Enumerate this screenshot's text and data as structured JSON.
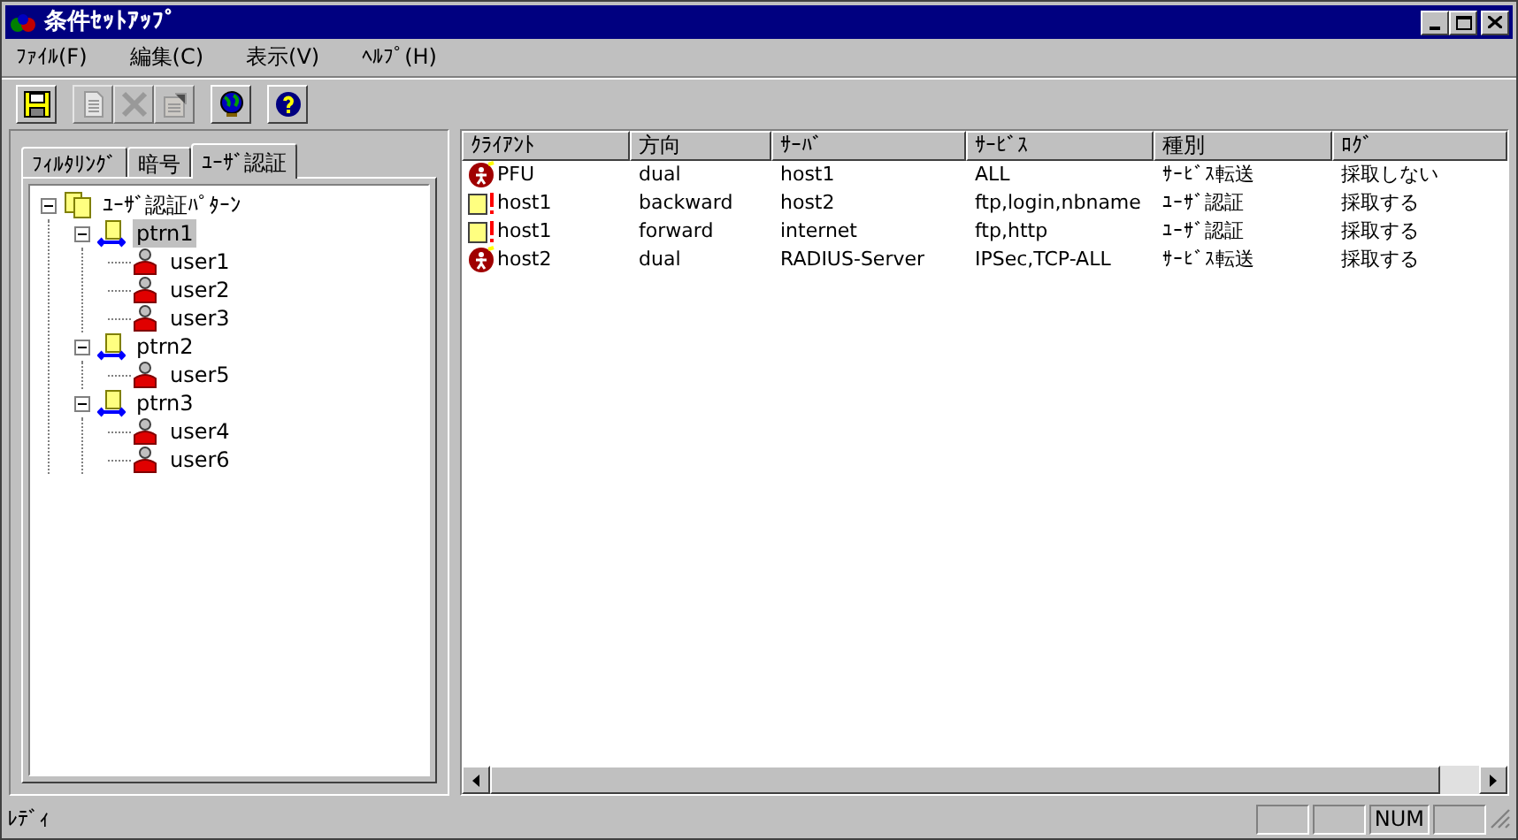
{
  "window": {
    "title": "条件ｾｯﾄｱｯﾌﾟ"
  },
  "menu": [
    "ﾌｧｲﾙ(F)",
    "編集(C)",
    "表示(V)",
    "ﾍﾙﾌﾟ(H)"
  ],
  "toolbar": [
    {
      "kind": "save",
      "disabled": false
    },
    {
      "kind": "new",
      "disabled": true
    },
    {
      "kind": "delete",
      "disabled": true
    },
    {
      "kind": "properties",
      "disabled": true
    },
    {
      "kind": "globe",
      "disabled": false
    },
    {
      "kind": "help",
      "disabled": false
    }
  ],
  "tabs": [
    {
      "label": "ﾌｨﾙﾀﾘﾝｸﾞ",
      "selected": false
    },
    {
      "label": "暗号",
      "selected": false
    },
    {
      "label": "ﾕｰｻﾞ認証",
      "selected": true
    }
  ],
  "tree": [
    {
      "label": "ﾕｰｻﾞ認証ﾊﾟﾀｰﾝ",
      "kind": "root",
      "expanded": true,
      "selected": false,
      "children": [
        {
          "label": "ptrn1",
          "kind": "pattern",
          "expanded": true,
          "selected": true,
          "children": [
            {
              "label": "user1",
              "kind": "user",
              "selected": false
            },
            {
              "label": "user2",
              "kind": "user",
              "selected": false
            },
            {
              "label": "user3",
              "kind": "user",
              "selected": false
            }
          ]
        },
        {
          "label": "ptrn2",
          "kind": "pattern",
          "expanded": true,
          "selected": false,
          "children": [
            {
              "label": "user5",
              "kind": "user",
              "selected": false
            }
          ]
        },
        {
          "label": "ptrn3",
          "kind": "pattern",
          "expanded": true,
          "selected": false,
          "children": [
            {
              "label": "user4",
              "kind": "user",
              "selected": false
            },
            {
              "label": "user6",
              "kind": "user",
              "selected": false
            }
          ]
        }
      ]
    }
  ],
  "table": {
    "columns": [
      "ｸﾗｲｱﾝﾄ",
      "方向",
      "ｻｰﾊﾞ",
      "ｻｰﾋﾞｽ",
      "種別",
      "ﾛｸﾞ"
    ],
    "rows": [
      {
        "kind": "service",
        "cells": [
          "PFU",
          "dual",
          "host1",
          "ALL",
          "ｻｰﾋﾞｽ転送",
          "採取しない"
        ]
      },
      {
        "kind": "auth",
        "cells": [
          "host1",
          "backward",
          "host2",
          "ftp,login,nbname",
          "ﾕｰｻﾞ認証",
          "採取する"
        ]
      },
      {
        "kind": "auth",
        "cells": [
          "host1",
          "forward",
          "internet",
          "ftp,http",
          "ﾕｰｻﾞ認証",
          "採取する"
        ]
      },
      {
        "kind": "service",
        "cells": [
          "host2",
          "dual",
          "RADIUS-Server",
          "IPSec,TCP-ALL",
          "ｻｰﾋﾞｽ転送",
          "採取する"
        ]
      }
    ]
  },
  "status_bar": {
    "text": "ﾚﾃﾞｨ",
    "indicators": [
      "NUM"
    ]
  }
}
